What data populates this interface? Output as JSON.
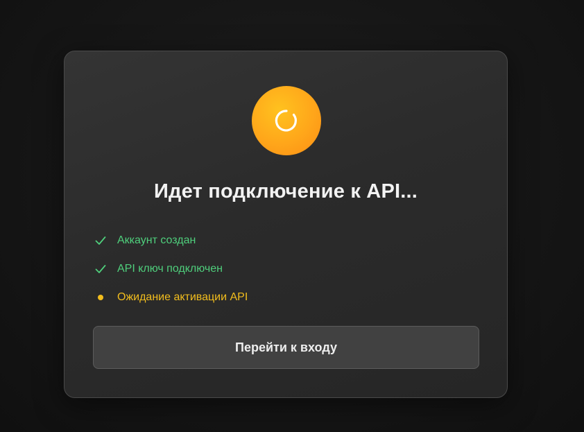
{
  "dialog": {
    "title": "Идет подключение к API...",
    "status_icon": "spinner-icon",
    "accent_color": "#ffa61a",
    "steps": [
      {
        "label": "Аккаунт создан",
        "state": "done",
        "icon": "checkmark-icon",
        "color": "#4fcf7c"
      },
      {
        "label": "API ключ подключен",
        "state": "done",
        "icon": "checkmark-icon",
        "color": "#4fcf7c"
      },
      {
        "label": "Ожидание активации API",
        "state": "pending",
        "icon": "dot-icon",
        "color": "#f2bd1d"
      }
    ],
    "button_label": "Перейти к входу"
  }
}
